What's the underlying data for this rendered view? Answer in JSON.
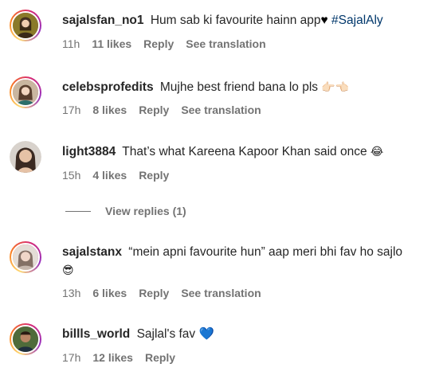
{
  "comments": [
    {
      "username": "sajalsfan_no1",
      "text": "Hum sab ki favourite hainn app",
      "emoji": "♥",
      "hashtag": "#SajalAly",
      "time": "11h",
      "likes": "11 likes",
      "reply": "Reply",
      "translate": "See translation"
    },
    {
      "username": "celebsprofedits",
      "text": "Mujhe best friend bana lo pls",
      "emoji": "👉🏻👈🏻",
      "time": "17h",
      "likes": "8 likes",
      "reply": "Reply",
      "translate": "See translation"
    },
    {
      "username": "light3884",
      "text": "That’s what Kareena Kapoor Khan said once",
      "emoji": "😂",
      "time": "15h",
      "likes": "4 likes",
      "reply": "Reply"
    },
    {
      "username": "sajalstanx",
      "text": "“mein apni favourite hun” aap meri bhi fav ho sajlo",
      "emoji": "😎",
      "time": "13h",
      "likes": "6 likes",
      "reply": "Reply",
      "translate": "See translation"
    },
    {
      "username": "billls_world",
      "text": "Sajlal's fav",
      "emoji": "💙",
      "time": "17h",
      "likes": "12 likes",
      "reply": "Reply"
    }
  ],
  "view_replies": "View replies (1)",
  "icons": {
    "heart_black": "black-heart-icon",
    "heart_blue": "blue-heart-icon"
  },
  "colors": {
    "text": "#262626",
    "secondary": "#737373",
    "hashtag": "#00376b"
  }
}
